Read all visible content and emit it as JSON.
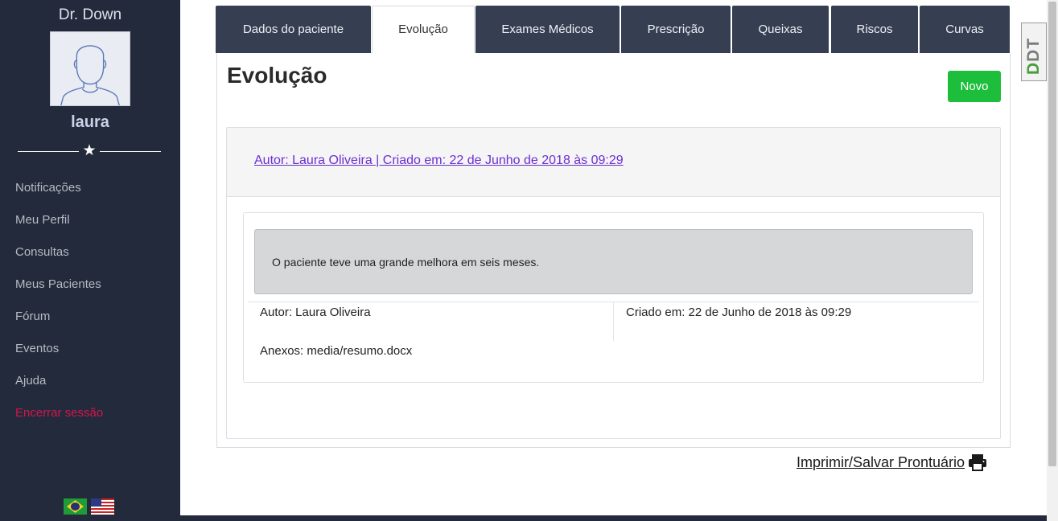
{
  "sidebar": {
    "brand": "Dr. Down",
    "username": "laura",
    "items": [
      "Notificações",
      "Meu Perfil",
      "Consultas",
      "Meus Pacientes",
      "Fórum",
      "Eventos",
      "Ajuda"
    ],
    "logout": "Encerrar sessão",
    "languages": [
      "Português (Brasil)",
      "English (US)"
    ]
  },
  "tabs": [
    "Dados do paciente",
    "Evolução",
    "Exames Médicos",
    "Prescrição",
    "Queixas",
    "Riscos",
    "Curvas"
  ],
  "active_tab": "Evolução",
  "page": {
    "title": "Evolução",
    "new_button": "Novo"
  },
  "evolution": {
    "header_link": "Autor: Laura Oliveira | Criado em: 22 de Junho de 2018 às 09:29",
    "text": "O paciente teve uma grande melhora em seis meses.",
    "author": "Autor: Laura Oliveira",
    "created": "Criado em: 22 de Junho de 2018 às 09:29",
    "attachments_label": "Anexos:",
    "attachment_file": "media/resumo.docx"
  },
  "print_link": "Imprimir/Salvar Prontuário",
  "logo": {
    "d": "D",
    "rest": "DT"
  },
  "colors": {
    "sidebar": "#232a3b",
    "tab": "#363f52",
    "accent_green": "#1cbe3b",
    "link": "#6b2fd4",
    "logout": "#d0174c"
  }
}
